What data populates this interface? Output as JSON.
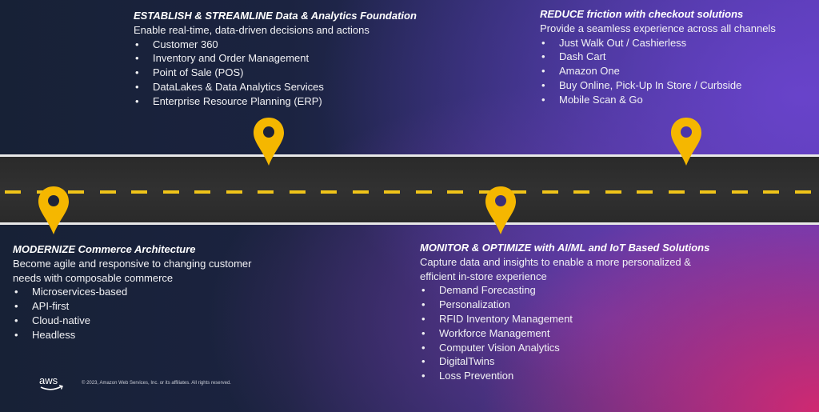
{
  "colors": {
    "pin": "#f5b700",
    "dash": "#f0c419",
    "road": "#2d2d2d",
    "road_edge": "#e8e8e8"
  },
  "blocks": {
    "establish": {
      "title": "ESTABLISH & STREAMLINE Data & Analytics Foundation",
      "subtitle": "Enable real-time, data-driven decisions and actions",
      "items": [
        "Customer 360",
        "Inventory and Order Management",
        "Point of Sale (POS)",
        "DataLakes & Data Analytics Services",
        "Enterprise Resource Planning (ERP)"
      ]
    },
    "reduce": {
      "title": "REDUCE friction with checkout solutions",
      "subtitle": "Provide a seamless experience across all channels",
      "items": [
        "Just Walk Out / Cashierless",
        "Dash Cart",
        "Amazon One",
        "Buy Online, Pick-Up In Store / Curbside",
        "Mobile Scan & Go"
      ]
    },
    "modernize": {
      "title": "MODERNIZE Commerce Architecture",
      "subtitle_line1": "Become agile and responsive to changing customer",
      "subtitle_line2": "needs with composable commerce",
      "items": [
        "Microservices-based",
        "API-first",
        "Cloud-native",
        "Headless"
      ]
    },
    "monitor": {
      "title": "MONITOR & OPTIMIZE with AI/ML and IoT Based Solutions",
      "subtitle_line1": "Capture data and insights to enable a more personalized &",
      "subtitle_line2": "efficient in-store experience",
      "items": [
        "Demand Forecasting",
        "Personalization",
        "RFID Inventory Management",
        "Workforce Management",
        "Computer Vision Analytics",
        "DigitalTwins",
        "Loss Prevention"
      ]
    }
  },
  "bullet": "•",
  "footer": {
    "logo_text": "aws",
    "copyright": "© 2023, Amazon Web Services, Inc. or its affiliates. All rights reserved."
  }
}
